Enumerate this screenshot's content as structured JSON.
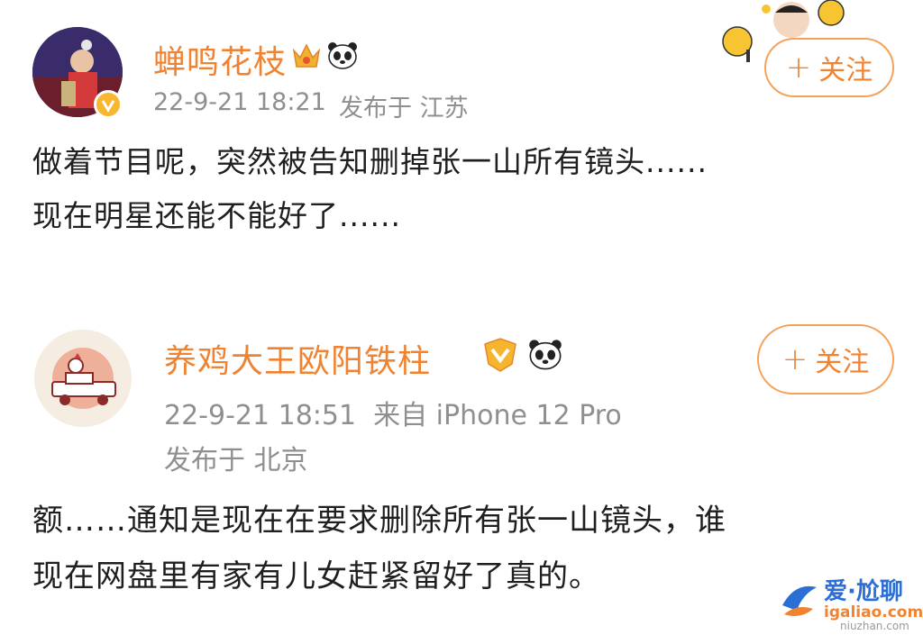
{
  "post1": {
    "username": "蝉鸣花枝",
    "time": "22-9-21 18:21",
    "location": "发布于 江苏",
    "follow_label": "关注",
    "text_line1": "做着节目呢，突然被告知删掉张一山所有镜头......",
    "text_line2": "现在明星还能不能好了......"
  },
  "post2": {
    "username": "养鸡大王欧阳铁柱",
    "time_source": "22-9-21 18:51  来自 iPhone 12 Pro",
    "location": "发布于 北京",
    "follow_label": "关注",
    "text_line1": "额……通知是现在在要求删除所有张一山镜头，谁",
    "text_line2": "现在网盘里有家有儿女赶紧留好了真的。"
  },
  "watermark": {
    "title": "爱·尬聊",
    "domain": "igaliao.com",
    "sub": "niuzhan.com"
  },
  "colors": {
    "accent": "#f08331",
    "meta": "#8f8f8f",
    "text": "#1f1f1f"
  }
}
